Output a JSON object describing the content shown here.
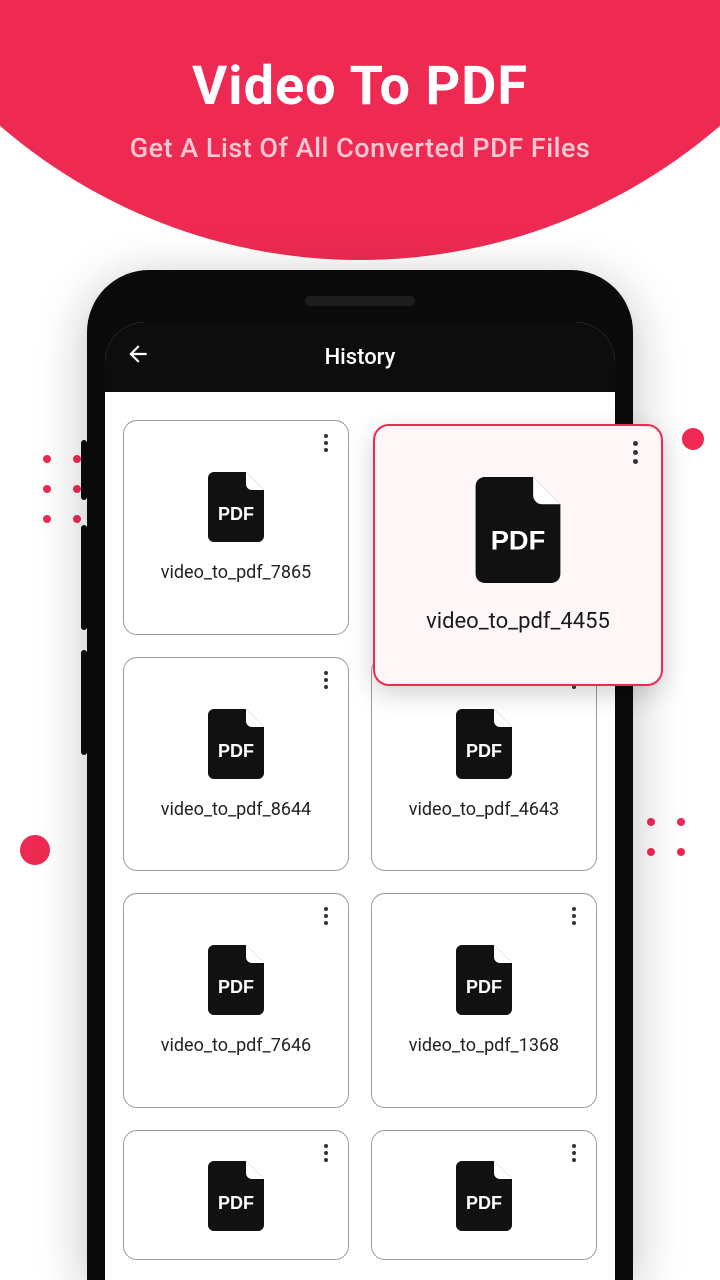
{
  "hero": {
    "title": "Video To PDF",
    "subtitle": "Get A List Of All Converted PDF Files"
  },
  "appbar": {
    "title": "History"
  },
  "featured": {
    "label": "video_to_pdf_4455"
  },
  "files": [
    {
      "label": "video_to_pdf_7865"
    },
    {
      "label": "video_to_pdf_8644"
    },
    {
      "label": "video_to_pdf_4643"
    },
    {
      "label": "video_to_pdf_7646"
    },
    {
      "label": "video_to_pdf_1368"
    }
  ],
  "colors": {
    "accent": "#ef2a52"
  }
}
